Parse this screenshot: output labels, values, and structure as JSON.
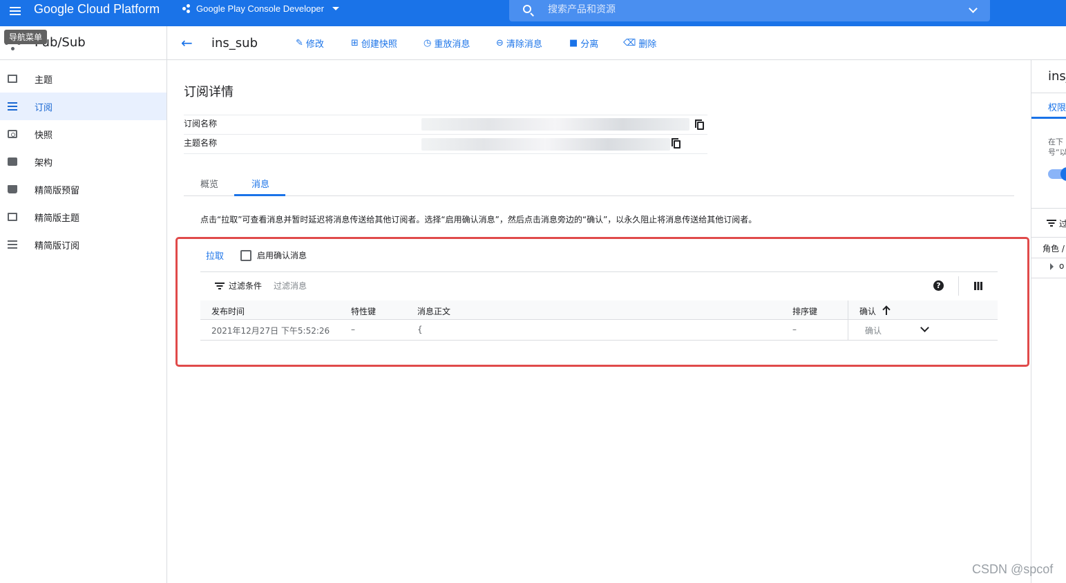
{
  "topbar": {
    "menu_tooltip": "导航菜单",
    "brand": "Google Cloud Platform",
    "project": "Google Play Console Developer",
    "search_placeholder": "搜索产品和资源"
  },
  "sidebar": {
    "title": "Pub/Sub",
    "items": [
      {
        "label": "主题",
        "icon": "message-icon",
        "active": false
      },
      {
        "label": "订阅",
        "icon": "list-icon",
        "active": true
      },
      {
        "label": "快照",
        "icon": "snapshot-icon",
        "active": false
      },
      {
        "label": "架构",
        "icon": "code-icon",
        "active": false
      },
      {
        "label": "精简版预留",
        "icon": "archive-icon",
        "active": false
      },
      {
        "label": "精简版主题",
        "icon": "message-icon",
        "active": false
      },
      {
        "label": "精简版订阅",
        "icon": "list-icon",
        "active": false
      }
    ]
  },
  "toolbar": {
    "resource_name": "ins_sub",
    "edit": "修改",
    "create_snapshot": "创建快照",
    "replay": "重放消息",
    "purge": "清除消息",
    "detach": "分离",
    "delete": "删除"
  },
  "details": {
    "title": "订阅详情",
    "subscription_label": "订阅名称",
    "topic_label": "主题名称"
  },
  "tabs": {
    "overview": "概览",
    "messages": "消息"
  },
  "messages": {
    "hint": "点击“拉取”可查看消息并暂时延迟将消息传送给其他订阅者。选择“启用确认消息”，然后点击消息旁边的“确认”，以永久阻止将消息传送给其他订阅者。",
    "pull": "拉取",
    "enable_ack": "启用确认消息",
    "filter_label": "过滤条件",
    "filter_placeholder": "过滤消息",
    "columns": {
      "publish_time": "发布时间",
      "attribute_keys": "特性键",
      "body": "消息正文",
      "ordering_key": "排序键",
      "ack": "确认"
    },
    "rows": [
      {
        "publish_time": "2021年12月27日 下午5:52:26",
        "attribute_keys": "–",
        "body": "{",
        "ordering_key": "–",
        "ack": "确认"
      }
    ]
  },
  "right_panel": {
    "title": "ins_",
    "tab": "权限",
    "desc": "在下 号“以",
    "filter": "过",
    "role": "角色 /",
    "item": "o"
  },
  "watermark": "CSDN @spcof",
  "colors": {
    "brand_blue": "#1a73e8",
    "highlight_red": "#e04a4a",
    "active_nav_bg": "#e8f0fe"
  }
}
